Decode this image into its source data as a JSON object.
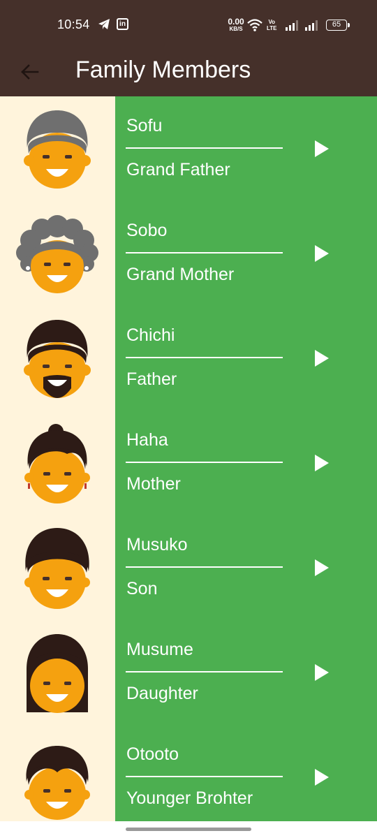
{
  "status_bar": {
    "time": "10:54",
    "net_speed_value": "0.00",
    "net_speed_unit": "KB/S",
    "volte_top": "Vo",
    "volte_bottom": "LTE",
    "battery": "65",
    "icons": [
      "telegram-icon",
      "linkedin-icon",
      "wifi-icon",
      "signal-icon",
      "battery-icon"
    ]
  },
  "app_bar": {
    "title": "Family Members",
    "back_icon": "arrow-left-icon"
  },
  "colors": {
    "app_bar": "#45302a",
    "avatar_bg": "#fff4dc",
    "row_bg": "#4caf50",
    "text": "#ffffff",
    "skin": "#f5a10f"
  },
  "members": [
    {
      "name": "Sofu",
      "relation": "Grand Father",
      "avatar": "grandfather-avatar"
    },
    {
      "name": "Sobo",
      "relation": "Grand Mother",
      "avatar": "grandmother-avatar"
    },
    {
      "name": "Chichi",
      "relation": "Father",
      "avatar": "father-avatar"
    },
    {
      "name": "Haha",
      "relation": "Mother",
      "avatar": "mother-avatar"
    },
    {
      "name": "Musuko",
      "relation": "Son",
      "avatar": "son-avatar"
    },
    {
      "name": "Musume",
      "relation": "Daughter",
      "avatar": "daughter-avatar"
    },
    {
      "name": "Otooto",
      "relation": "Younger Brohter",
      "avatar": "younger-brother-avatar"
    }
  ]
}
